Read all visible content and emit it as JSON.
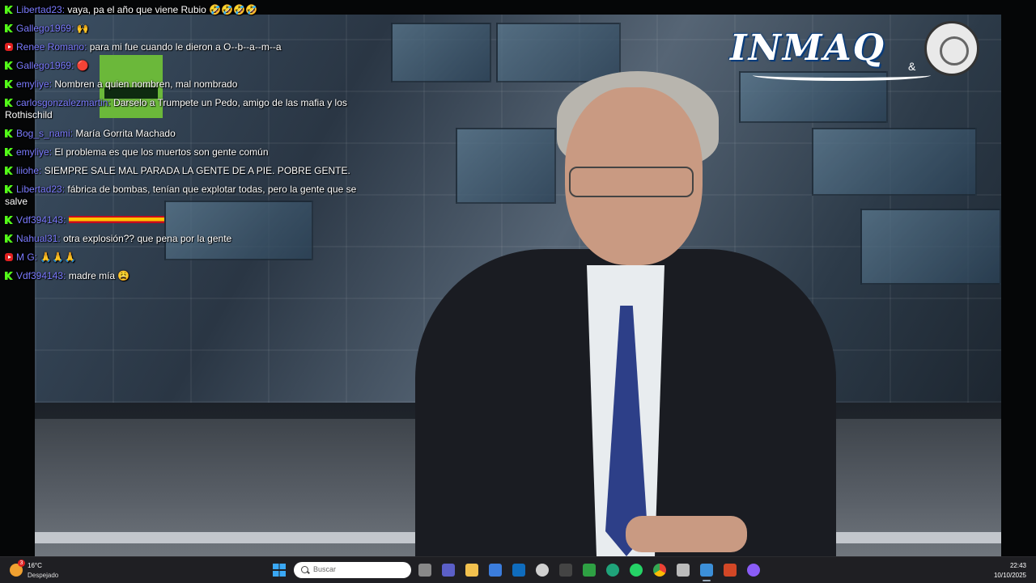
{
  "chat": {
    "messages": [
      {
        "platform": "kick",
        "user": "Libertad23",
        "text": "vaya, pa el año que viene Rubio 🤣🤣🤣🤣"
      },
      {
        "platform": "kick",
        "user": "Gallego1969",
        "text": "🙌"
      },
      {
        "platform": "youtube",
        "user": "Renee Romano",
        "text": "para mi fue cuando le dieron a O--b--a--m--a"
      },
      {
        "platform": "kick",
        "user": "Gallego1969",
        "text": "🔴"
      },
      {
        "platform": "kick",
        "user": "emyliye",
        "text": "Nombren a quien nombren, mal nombrado"
      },
      {
        "platform": "kick",
        "user": "carlosgonzalezmartin",
        "text": "Darselo a Trumpete un Pedo, amigo de las mafia y los Rothischild"
      },
      {
        "platform": "kick",
        "user": "Bog_s_nami",
        "text": "María Gorrita Machado"
      },
      {
        "platform": "kick",
        "user": "emyliye",
        "text": "El problema es que los muertos son gente común"
      },
      {
        "platform": "kick",
        "user": "liiohe",
        "text": "SIEMPRE SALE MAL PARADA LA GENTE DE A PIE. POBRE GENTE."
      },
      {
        "platform": "kick",
        "user": "Libertad23",
        "text": "fábrica de bombas, tenían que explotar todas, pero la gente que se salve"
      },
      {
        "platform": "kick",
        "user": "Vdf394143",
        "text": "",
        "flags": true
      },
      {
        "platform": "kick",
        "user": "Nahual31",
        "text": "otra explosión?? que pena por la gente"
      },
      {
        "platform": "youtube",
        "user": "M G",
        "text": "🙏🙏🙏"
      },
      {
        "platform": "kick",
        "user": "Vdf394143",
        "text": "madre mía 😩"
      }
    ]
  },
  "brand": {
    "logo_text": "INMAQ",
    "amp": "&"
  },
  "taskbar": {
    "weather_temp": "16°C",
    "weather_desc": "Despejado",
    "weather_badge": "3",
    "search_placeholder": "Buscar",
    "time": "22:43",
    "date": "10/10/2025",
    "apps": [
      "task-view",
      "teams",
      "file-explorer",
      "store",
      "outlook",
      "clipchamp",
      "app-unknown",
      "camtasia",
      "edge",
      "whatsapp",
      "chrome",
      "security",
      "web-app-active",
      "powerpoint",
      "cortana"
    ]
  }
}
